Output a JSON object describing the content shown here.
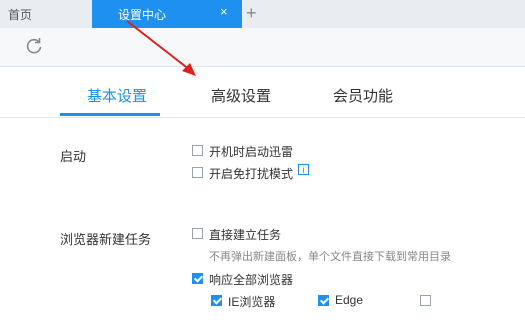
{
  "tabs": {
    "home_label": "首页",
    "active_label": "设置中心",
    "close_glyph": "×",
    "new_tab_glyph": "+"
  },
  "settings_tabs": [
    {
      "label": "基本设置",
      "active": true
    },
    {
      "label": "高级设置",
      "active": false
    },
    {
      "label": "会员功能",
      "active": false
    }
  ],
  "sections": {
    "startup": {
      "title": "启动",
      "options": [
        {
          "label": "开机时启动迅雷",
          "checked": false
        },
        {
          "label": "开启免打扰模式",
          "checked": false,
          "info_glyph": "i"
        }
      ]
    },
    "browser": {
      "title": "浏览器新建任务",
      "direct": {
        "label": "直接建立任务",
        "checked": false,
        "hint": "不再弹出新建面板，单个文件直接下载到常用目录"
      },
      "respond_all": {
        "label": "响应全部浏览器",
        "checked": true
      },
      "browsers": [
        {
          "label": "IE浏览器",
          "checked": true
        },
        {
          "label": "Edge",
          "checked": true
        },
        {
          "label": "",
          "checked": false
        }
      ]
    }
  },
  "colors": {
    "accent": "#1e90f0",
    "arrow": "#e02020"
  },
  "icons": {
    "refresh": "refresh-icon",
    "info": "info-icon",
    "close": "close-icon"
  }
}
